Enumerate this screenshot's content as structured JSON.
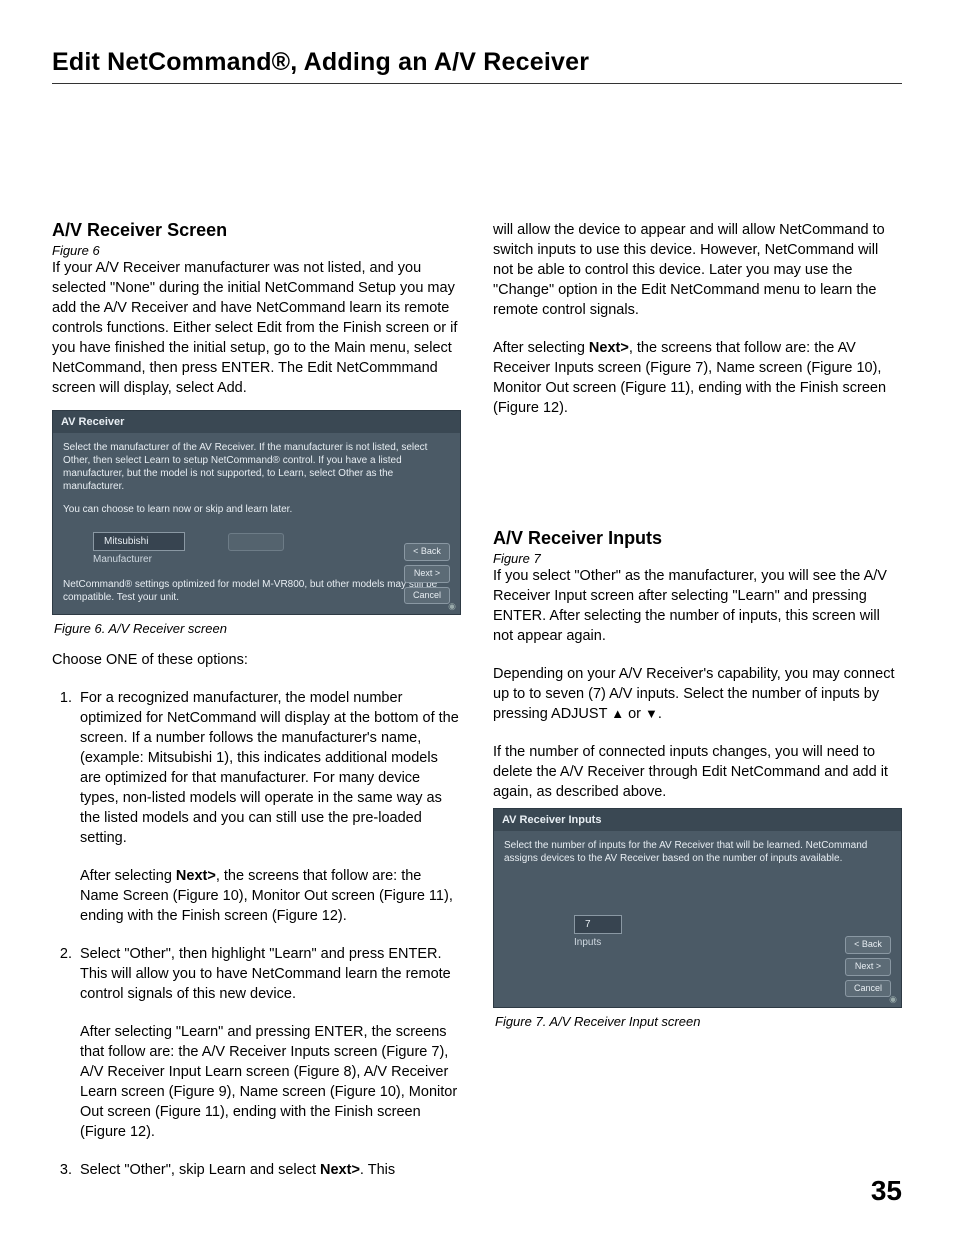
{
  "page_title": "Edit NetCommand®, Adding an A/V Receiver",
  "page_number": "35",
  "left": {
    "h2": "A/V Receiver Screen",
    "figref": "Figure 6",
    "intro": "If your A/V Receiver manufacturer was not listed, and you selected \"None\" during the initial NetCommand Setup you may add the A/V Receiver and have NetCommand learn its remote controls functions.  Either select Edit from the Finish screen or if you have  finished the initial setup, go to the Main menu, select NetCommand, then press ENTER.   The Edit NetCommmand screen will display, select Add.",
    "caption": "Figure 6.  A/V Receiver screen",
    "choose": "Choose ONE of these options:",
    "li1": "For a recognized manufacturer, the model number optimized for NetCommand will display at the bottom of the screen.  If a number follows the manufacturer's name, (example: Mitsubishi 1), this indicates additional models are optimized for that manufacturer.  For many device types, non-listed models will operate in the same way as the listed models and you can still use the pre-loaded setting.",
    "li1_p_a": "After selecting ",
    "li1_p_bold": "Next>",
    "li1_p_b": ", the screens that follow are: the Name Screen (Figure 10), Monitor Out screen (Figure 11), ending with the Finish screen (Figure 12).",
    "li2": "Select \"Other\", then highlight \"Learn\" and press ENTER.  This will allow you to have NetCommand learn the remote control signals of this new device.",
    "li2_p": "After selecting \"Learn\" and pressing ENTER, the screens that follow are: the A/V Receiver Inputs screen (Figure 7), A/V Receiver Input Learn screen (Figure 8), A/V Receiver Learn screen (Figure 9), Name screen (Figure 10), Monitor Out screen (Figure 11), ending with the Finish screen (Figure 12).",
    "li3_a": "Select \"Other\", skip Learn and select ",
    "li3_bold": "Next>",
    "li3_b": ".  This"
  },
  "right": {
    "cont": "will allow the device to appear and will allow NetCommand to switch inputs to use this device.  However, NetCommand will not be able to control this device.  Later you may use the \"Change\" option in the Edit NetCommand menu to learn the remote control signals.",
    "after_a": "After selecting ",
    "after_bold": "Next>",
    "after_b": ", the screens that follow are: the AV Receiver Inputs screen (Figure 7), Name screen (Figure 10), Monitor Out screen (Figure 11), ending with the Finish screen (Figure 12).",
    "h2": "A/V Receiver Inputs",
    "figref": "Figure 7",
    "p1": "If  you select \"Other\" as the manufacturer, you will see the A/V Receiver Input screen after selecting \"Learn\" and pressing ENTER.  After selecting the number of inputs, this screen will not appear again.",
    "p2_a": "Depending on your A/V Receiver's capability, you may connect up to to seven (7) A/V inputs.  Select the number of inputs by pressing  ADJUST ",
    "p2_b": " or ",
    "p2_c": ".",
    "p3": "If the number of connected inputs changes, you will need to delete the A/V Receiver through Edit NetCommand and add it again, as described above.",
    "caption": "Figure 7.  A/V Receiver  Input screen"
  },
  "shot1": {
    "title": "AV Receiver",
    "txt1": "Select the manufacturer of the AV Receiver.  If the manufacturer is not listed, select Other, then select Learn to setup NetCommand® control.  If you have a listed manufacturer, but the model is not supported, to Learn, select Other as the manufacturer.",
    "txt2": "You can choose to learn now or skip and learn later.",
    "field": "Mitsubishi",
    "label": "Manufacturer",
    "foot": "NetCommand® settings optimized for model M-VR800, but other models may still be compatible. Test your unit.",
    "back": "< Back",
    "next": "Next >",
    "cancel": "Cancel"
  },
  "shot2": {
    "title": "AV Receiver Inputs",
    "txt1": "Select the number of inputs for the AV Receiver that will be learned.  NetCommand assigns devices to the AV Receiver based on the number of inputs available.",
    "field": "7",
    "label": "Inputs",
    "back": "< Back",
    "next": "Next >",
    "cancel": "Cancel"
  }
}
